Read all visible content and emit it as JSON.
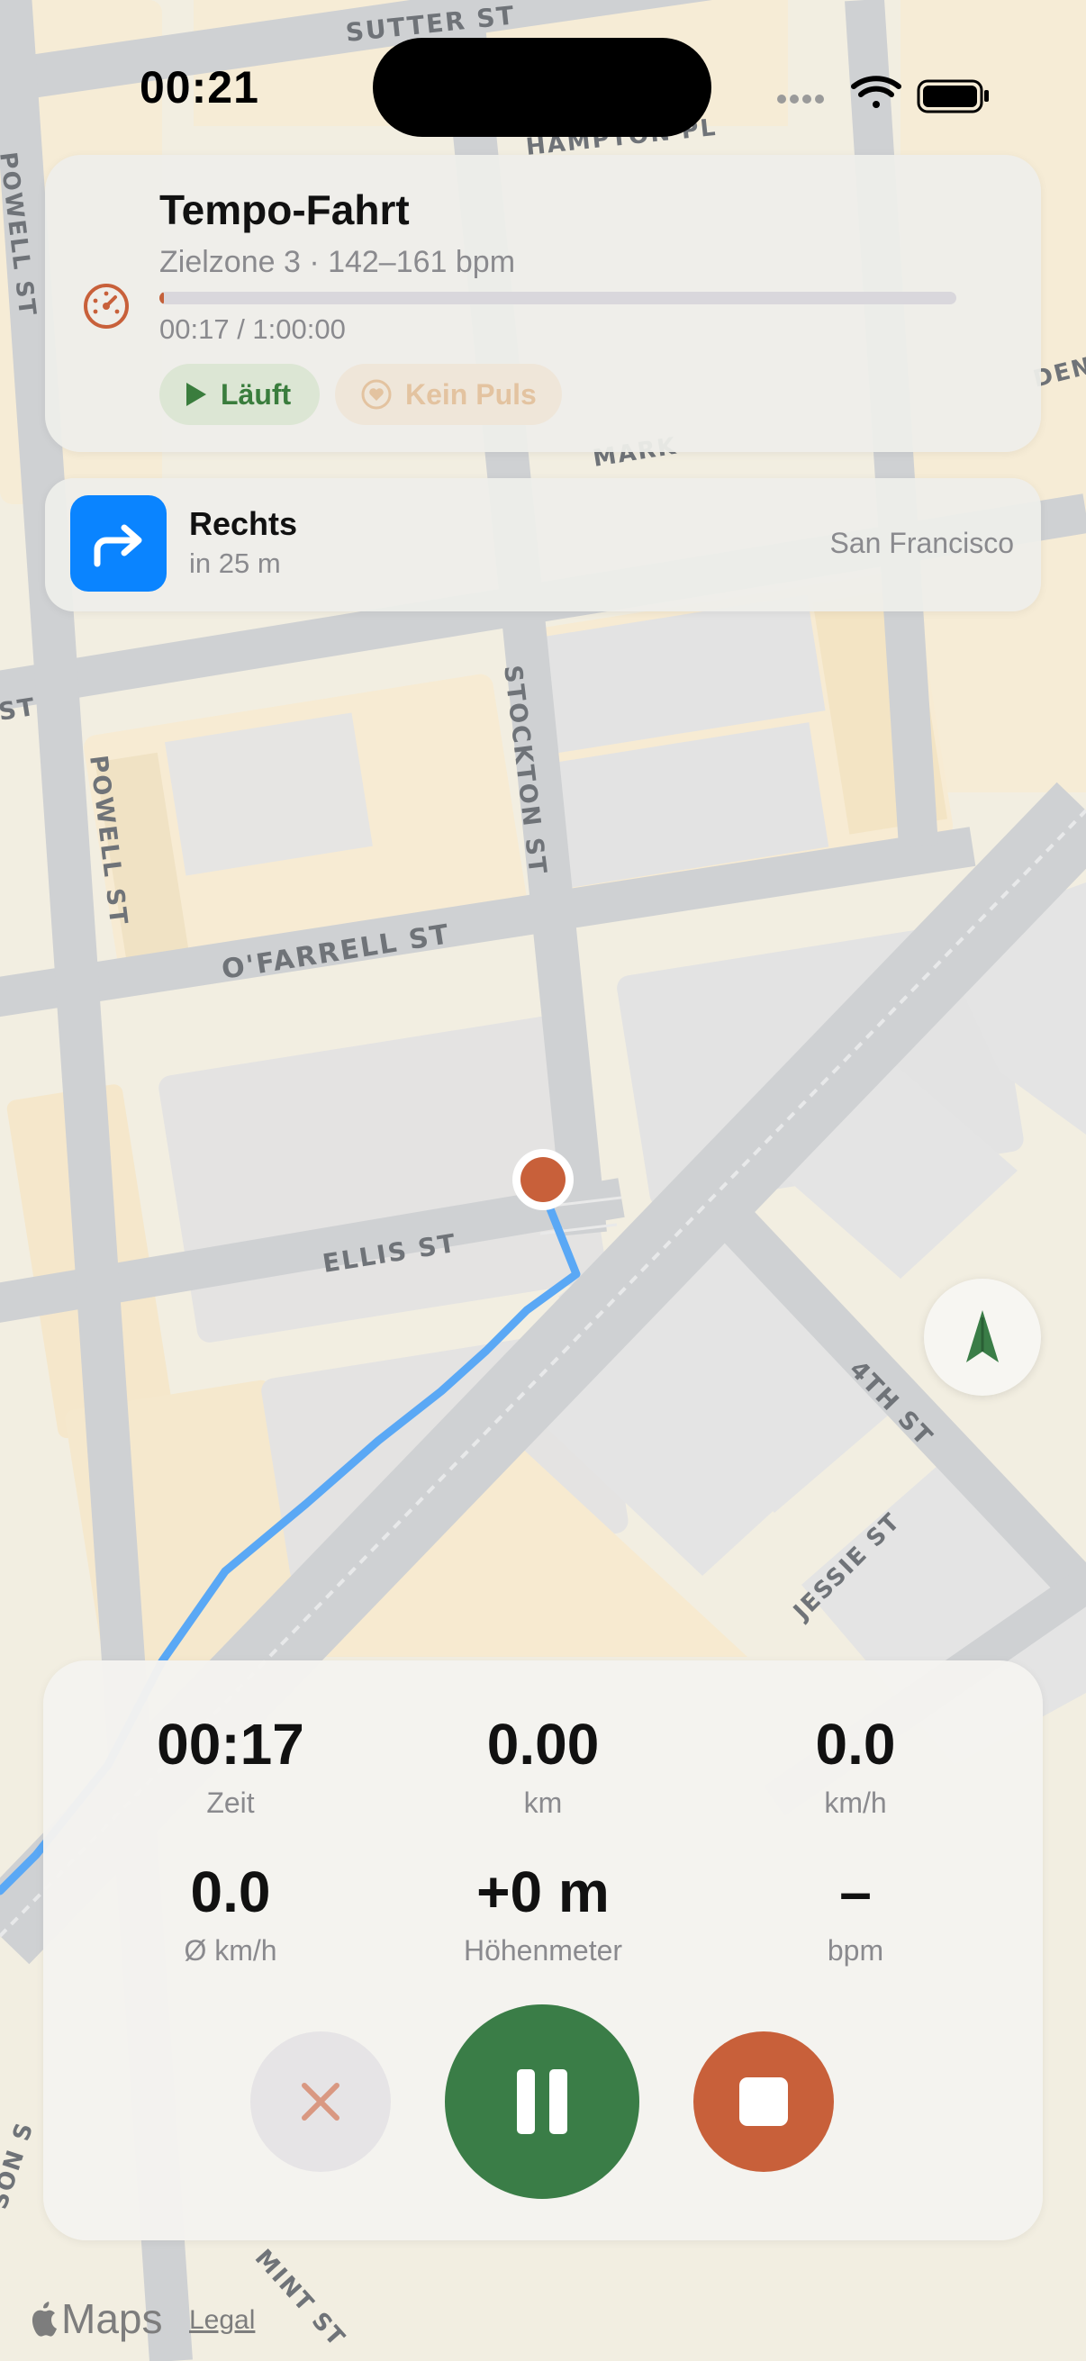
{
  "status_bar": {
    "time": "00:21"
  },
  "map": {
    "streets": {
      "sutter": "SUTTER ST",
      "hampton": "HAMPTON PL",
      "powell_upper": "POWELL ST",
      "powell": "POWELL ST",
      "stockton": "STOCKTON ST",
      "ofarrell": "O'FARRELL ST",
      "ellis": "ELLIS ST",
      "fourth": "4TH ST",
      "jessie": "JESSIE ST",
      "market": "MARK",
      "st_left": "ST",
      "den": "DEN",
      "mint": "MINT ST",
      "mason": "SON S"
    },
    "attribution": {
      "brand": "Maps",
      "legal": "Legal"
    }
  },
  "workout": {
    "title": "Tempo-Fahrt",
    "zone": "Zielzone 3 · 142–161 bpm",
    "elapsed": "00:17 / 1:00:00",
    "progress": 0.005,
    "status_running": "Läuft",
    "status_pulse": "Kein Puls",
    "icon": "speedometer-icon"
  },
  "navigation": {
    "instruction": "Rechts",
    "distance": "in 25 m",
    "city": "San Francisco",
    "icon": "turn-right-icon"
  },
  "stats": [
    {
      "value": "00:17",
      "label": "Zeit"
    },
    {
      "value": "0.00",
      "label": "km"
    },
    {
      "value": "0.0",
      "label": "km/h"
    },
    {
      "value": "0.0",
      "label": "Ø km/h"
    },
    {
      "value": "+0 m",
      "label": "Höhenmeter"
    },
    {
      "value": "–",
      "label": "bpm"
    }
  ],
  "controls": {
    "discard_icon": "close-icon",
    "pause_icon": "pause-icon",
    "stop_icon": "stop-icon"
  },
  "colors": {
    "accent_green": "#3a7d47",
    "accent_orange": "#c8603a",
    "nav_blue": "#0a84ff",
    "route": "#5aa8f5"
  }
}
